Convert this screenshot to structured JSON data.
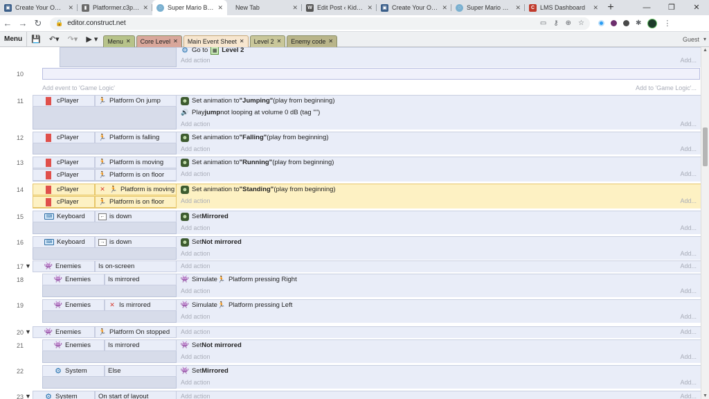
{
  "browser": {
    "tabs": [
      {
        "title": "Create Your Own G",
        "icon_color": "#3b5f8a"
      },
      {
        "title": "Platformer.c3p - G",
        "icon_color": "#6b6b6b"
      },
      {
        "title": "Super Mario Bros",
        "icon_color": "#7ab0d0",
        "active": true
      },
      {
        "title": "New Tab",
        "icon_color": ""
      },
      {
        "title": "Edit Post ‹ Kids Ko",
        "icon_color": "#555555"
      },
      {
        "title": "Create Your Own G",
        "icon_color": "#3b5f8a"
      },
      {
        "title": "Super Mario Bros",
        "icon_color": "#7ab0d0"
      },
      {
        "title": "LMS Dashboard",
        "icon_color": "#c0392b"
      }
    ],
    "url": "editor.construct.net"
  },
  "toolbar": {
    "menu_label": "Menu",
    "guest_label": "Guest",
    "doc_tabs": [
      {
        "label": "Menu",
        "color": "#b7c38a"
      },
      {
        "label": "Core Level",
        "color": "#d9a79b"
      },
      {
        "label": "Main Event Sheet",
        "color": "#f7e6cf",
        "active": true
      },
      {
        "label": "Level 2",
        "color": "#c9c79a"
      },
      {
        "label": "Enemy code",
        "color": "#b9b58a"
      }
    ]
  },
  "sheet": {
    "top_action": {
      "text": "Go to",
      "target": "Level 2",
      "add_action": "Add action",
      "add_dots": "Add..."
    },
    "line10": "10",
    "add_event_label": "Add event to 'Game Logic'",
    "add_event_right": "Add to 'Game Logic'...",
    "add_action": "Add action",
    "add_dots": "Add...",
    "events": {
      "e11": {
        "num": "11",
        "obj": "cPlayer",
        "cond": "Platform On jump",
        "a1_pre": "Set animation to ",
        "a1_val": "\"Jumping\"",
        "a1_post": " (play from beginning)",
        "a2_pre": "Play ",
        "a2_val": "jump",
        "a2_post": " not looping at volume 0 dB (tag \"\")"
      },
      "e12": {
        "num": "12",
        "obj": "cPlayer",
        "cond": "Platform is falling",
        "a1_pre": "Set animation to ",
        "a1_val": "\"Falling\"",
        "a1_post": " (play from beginning)"
      },
      "e13": {
        "num": "13",
        "obj": "cPlayer",
        "cond1": "Platform is moving",
        "obj2": "cPlayer",
        "cond2": "Platform is on floor",
        "a1_pre": "Set animation to ",
        "a1_val": "\"Running\"",
        "a1_post": " (play from beginning)"
      },
      "e14": {
        "num": "14",
        "obj": "cPlayer",
        "cond1": "Platform is moving",
        "obj2": "cPlayer",
        "cond2": "Platform is on floor",
        "a1_pre": "Set animation to ",
        "a1_val": "\"Standing\"",
        "a1_post": " (play from beginning)"
      },
      "e15": {
        "num": "15",
        "obj": "Keyboard",
        "key": "←",
        "cond": "is down",
        "a1_pre": "Set ",
        "a1_val": "Mirrored"
      },
      "e16": {
        "num": "16",
        "obj": "Keyboard",
        "key": "→",
        "cond": "is down",
        "a1_pre": "Set ",
        "a1_val": "Not mirrored"
      },
      "e17": {
        "num": "17",
        "obj": "Enemies",
        "cond": "Is on-screen"
      },
      "e18": {
        "num": "18",
        "obj": "Enemies",
        "cond": "Is mirrored",
        "a1_pre": "Simulate ",
        "a1_val": "Platform pressing Right"
      },
      "e19": {
        "num": "19",
        "obj": "Enemies",
        "cond": "Is mirrored",
        "a1_pre": "Simulate ",
        "a1_val": "Platform pressing Left"
      },
      "e20": {
        "num": "20",
        "obj": "Enemies",
        "cond": "Platform On stopped"
      },
      "e21": {
        "num": "21",
        "obj": "Enemies",
        "cond": "Is mirrored",
        "a1_pre": "Set ",
        "a1_val": "Not mirrored"
      },
      "e22": {
        "num": "22",
        "obj": "System",
        "cond": "Else",
        "a1_pre": "Set ",
        "a1_val": "Mirrored"
      },
      "e23": {
        "num": "23",
        "obj": "System",
        "cond": "On start of layout"
      }
    }
  }
}
